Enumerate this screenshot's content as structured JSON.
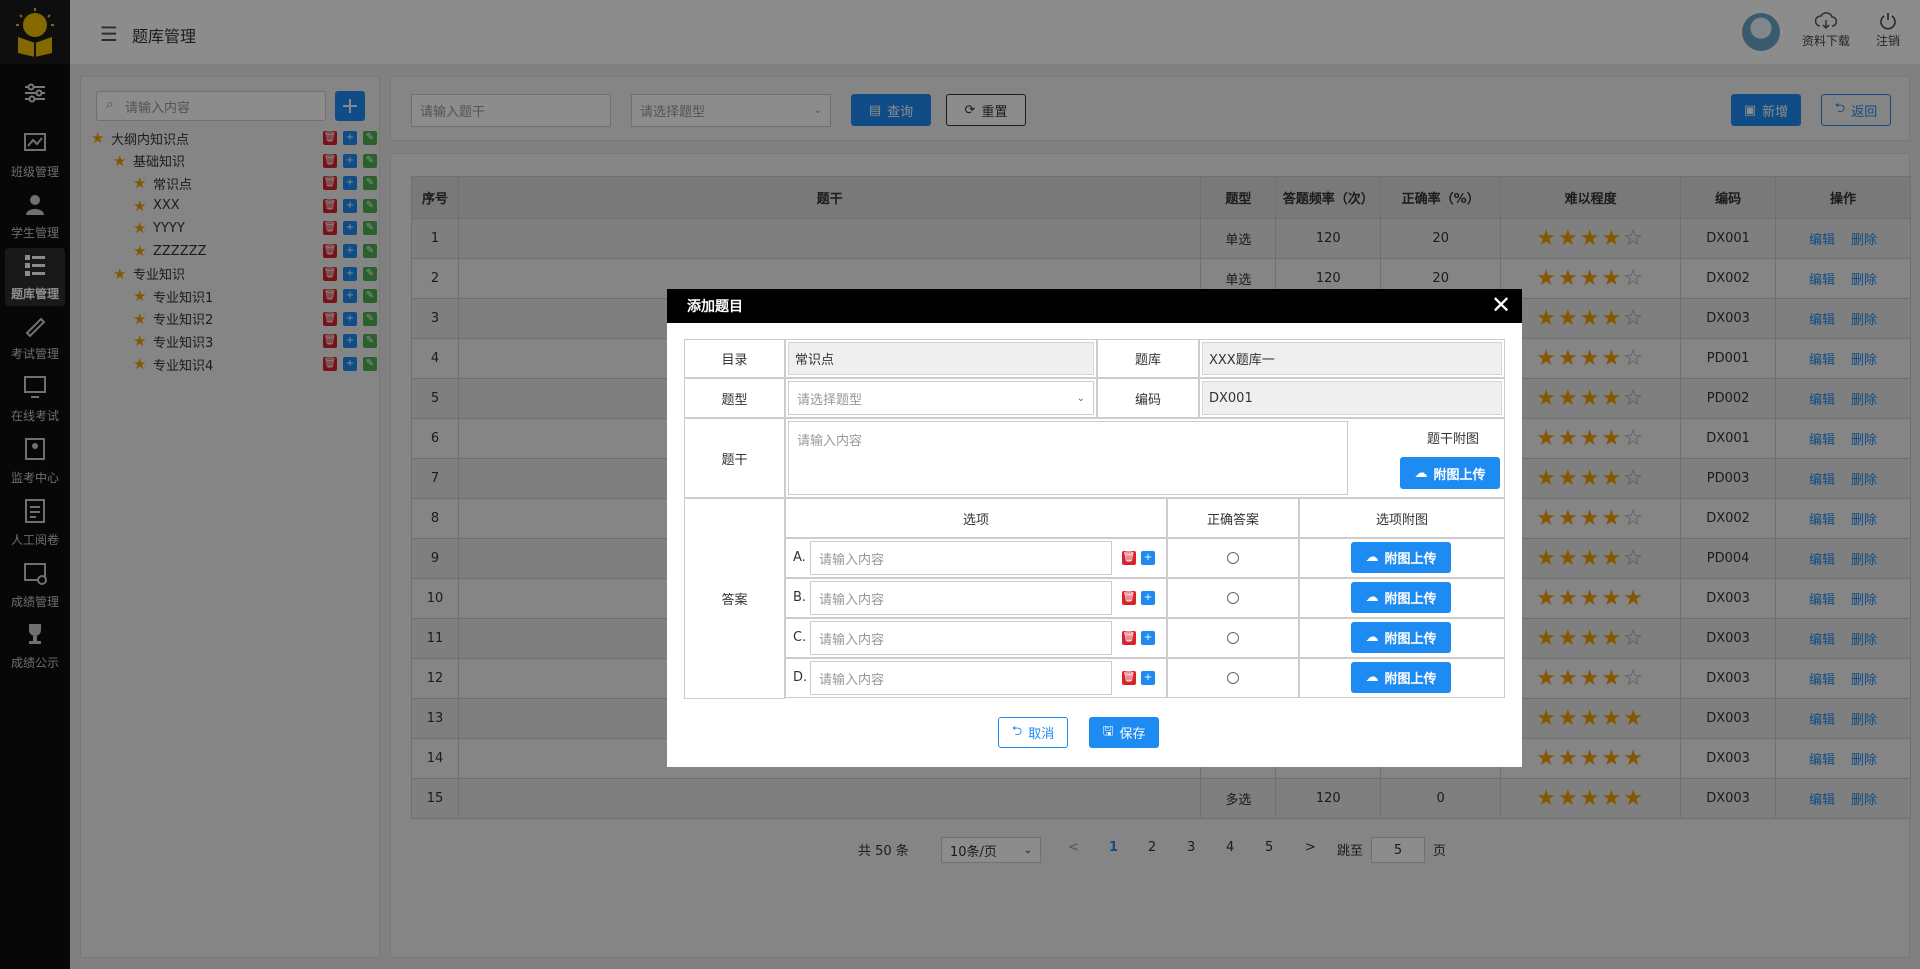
{
  "header": {
    "title": "题库管理",
    "download_label": "资料下载",
    "logout_label": "注销"
  },
  "rail": {
    "items": [
      {
        "label": "",
        "icon": "sliders-icon"
      },
      {
        "label": "班级管理",
        "icon": "class-icon"
      },
      {
        "label": "学生管理",
        "icon": "student-icon"
      },
      {
        "label": "题库管理",
        "icon": "question-bank-icon"
      },
      {
        "label": "考试管理",
        "icon": "exam-icon"
      },
      {
        "label": "在线考试",
        "icon": "online-exam-icon"
      },
      {
        "label": "监考中心",
        "icon": "proctor-icon"
      },
      {
        "label": "人工阅卷",
        "icon": "grading-icon"
      },
      {
        "label": "成绩管理",
        "icon": "score-icon"
      },
      {
        "label": "成绩公示",
        "icon": "trophy-icon"
      }
    ]
  },
  "tree": {
    "search_placeholder": "请输入内容",
    "nodes": [
      {
        "label": "大纲内知识点",
        "level": 0
      },
      {
        "label": "基础知识",
        "level": 1
      },
      {
        "label": "常识点",
        "level": 2
      },
      {
        "label": "XXX",
        "level": 2
      },
      {
        "label": "YYYY",
        "level": 2
      },
      {
        "label": "ZZZZZZ",
        "level": 2
      },
      {
        "label": "专业知识",
        "level": 1
      },
      {
        "label": "专业知识1",
        "level": 2
      },
      {
        "label": "专业知识2",
        "level": 2
      },
      {
        "label": "专业知识3",
        "level": 2
      },
      {
        "label": "专业知识4",
        "level": 2
      }
    ]
  },
  "toolbar": {
    "stem_placeholder": "请输入题干",
    "type_placeholder": "请选择题型",
    "query_label": "查询",
    "reset_label": "重置",
    "add_label": "新增",
    "back_label": "返回"
  },
  "table": {
    "columns": [
      "序号",
      "题干",
      "题型",
      "答题频率（次）",
      "正确率（%）",
      "难以程度",
      "编码",
      "操作"
    ],
    "edit_label": "编辑",
    "delete_label": "删除",
    "rows": [
      {
        "no": "1",
        "stem": "",
        "type": "单选",
        "freq": "120",
        "rate": "20",
        "stars": 4,
        "code": "DX001"
      },
      {
        "no": "2",
        "stem": "",
        "type": "单选",
        "freq": "120",
        "rate": "20",
        "stars": 4,
        "code": "DX002"
      },
      {
        "no": "3",
        "stem": "",
        "type": "",
        "freq": "",
        "rate": "",
        "stars": 4,
        "code": "DX003"
      },
      {
        "no": "4",
        "stem": "",
        "type": "",
        "freq": "",
        "rate": "",
        "stars": 4,
        "code": "PD001"
      },
      {
        "no": "5",
        "stem": "",
        "type": "",
        "freq": "",
        "rate": "",
        "stars": 4,
        "code": "PD002"
      },
      {
        "no": "6",
        "stem": "",
        "type": "",
        "freq": "",
        "rate": "",
        "stars": 4,
        "code": "DX001"
      },
      {
        "no": "7",
        "stem": "",
        "type": "",
        "freq": "",
        "rate": "",
        "stars": 4,
        "code": "PD003"
      },
      {
        "no": "8",
        "stem": "",
        "type": "",
        "freq": "",
        "rate": "",
        "stars": 4,
        "code": "DX002"
      },
      {
        "no": "9",
        "stem": "",
        "type": "",
        "freq": "",
        "rate": "",
        "stars": 4,
        "code": "PD004"
      },
      {
        "no": "10",
        "stem": "",
        "type": "",
        "freq": "",
        "rate": "",
        "stars": 5,
        "code": "DX003"
      },
      {
        "no": "11",
        "stem": "",
        "type": "",
        "freq": "",
        "rate": "",
        "stars": 4,
        "code": "DX003"
      },
      {
        "no": "12",
        "stem": "",
        "type": "",
        "freq": "",
        "rate": "",
        "stars": 4,
        "code": "DX003"
      },
      {
        "no": "13",
        "stem": "",
        "type": "",
        "freq": "",
        "rate": "",
        "stars": 5,
        "code": "DX003"
      },
      {
        "no": "14",
        "stem": "",
        "type": "",
        "freq": "",
        "rate": "",
        "stars": 5,
        "code": "DX003"
      },
      {
        "no": "15",
        "stem": "",
        "type": "多选",
        "freq": "120",
        "rate": "0",
        "stars": 5,
        "code": "DX003"
      }
    ]
  },
  "pagination": {
    "total": "共 50 条",
    "page_size": "10条/页",
    "prev": "<",
    "next": ">",
    "pages": [
      "1",
      "2",
      "3",
      "4",
      "5"
    ],
    "current": "1",
    "jump_label": "跳至",
    "jump_value": "5",
    "page_unit": "页"
  },
  "modal": {
    "title": "添加题目",
    "catalog_label": "目录",
    "catalog_value": "常识点",
    "bank_label": "题库",
    "bank_value": "XXX题库一",
    "type_label": "题型",
    "type_placeholder": "请选择题型",
    "code_label": "编码",
    "code_value": "DX001",
    "stem_label": "题干",
    "stem_placeholder": "请输入内容",
    "stem_image_label": "题干附图",
    "upload_label": "附图上传",
    "answer_label": "答案",
    "option_col": "选项",
    "correct_col": "正确答案",
    "option_image_col": "选项附图",
    "options": [
      {
        "letter": "A.",
        "placeholder": "请输入内容"
      },
      {
        "letter": "B.",
        "placeholder": "请输入内容"
      },
      {
        "letter": "C.",
        "placeholder": "请输入内容"
      },
      {
        "letter": "D.",
        "placeholder": "请输入内容"
      }
    ],
    "cancel_label": "取消",
    "save_label": "保存"
  },
  "colors": {
    "accent": "#1e8bf2",
    "star": "#f0a000",
    "danger": "#d9232d",
    "success": "#4caf50"
  }
}
